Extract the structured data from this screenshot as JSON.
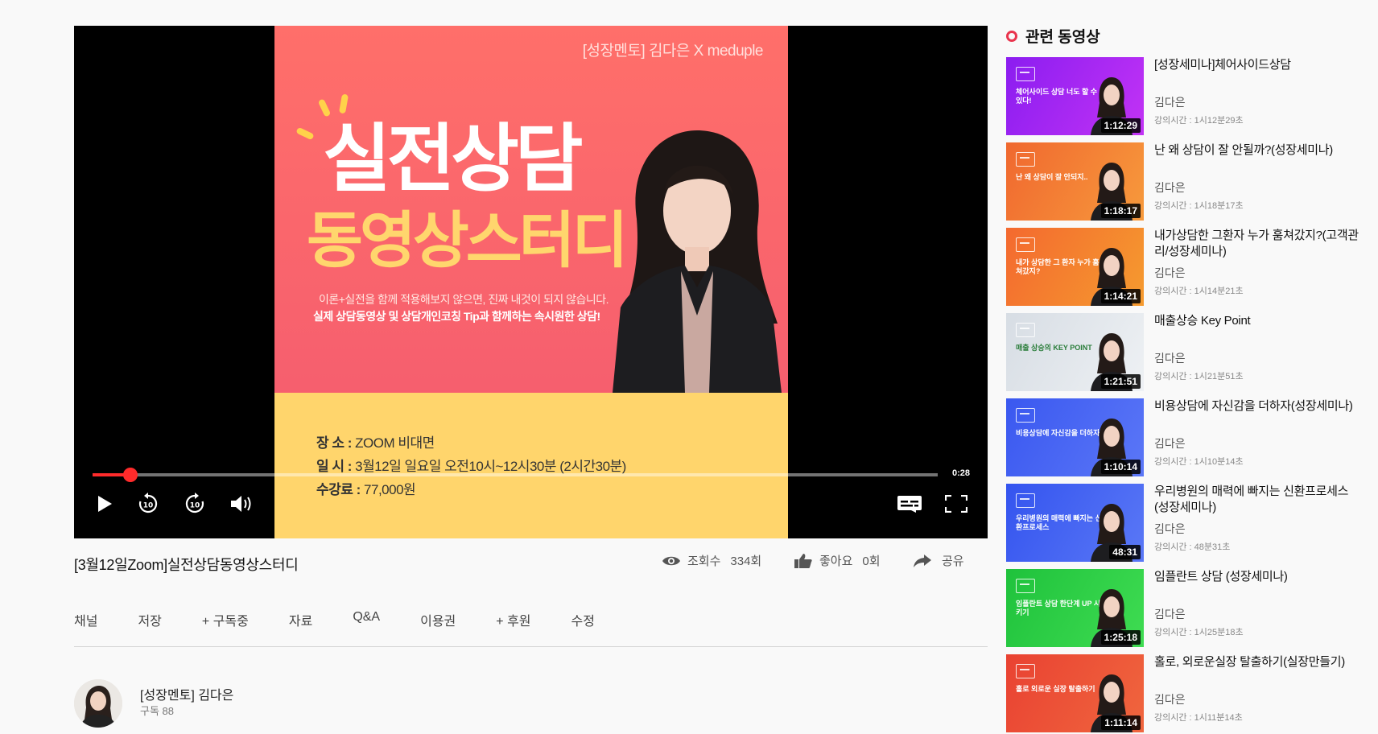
{
  "player": {
    "poster": {
      "brand": "[성장멘토] 김다은 X meduple",
      "title_line1": "실전상담",
      "title_line2": "동영상스터디",
      "subtitle_line1": "이론+실전을 함께 적용해보지 않으면, 진짜 내것이 되지 않습니다.",
      "subtitle_line2": "실제 상담동영상 및 상담개인코칭 Tip과 함께하는 속시원한 상담!",
      "info": [
        {
          "label": "장  소 :",
          "value": "ZOOM 비대면"
        },
        {
          "label": "일  시 :",
          "value": "3월12일 일요일 오전10시~12시30분 (2시간30분)"
        },
        {
          "label": "수강료 :",
          "value": "77,000원"
        }
      ]
    },
    "progress": 0.045,
    "current_time": "0:28",
    "colors": {
      "progress": "#ff2b2b",
      "poster_top": "#ff6f6a",
      "poster_bottom": "#ffd56c"
    }
  },
  "video": {
    "title": "[3월12일Zoom]실전상담동영상스터디",
    "views_label": "조회수",
    "views_value": "334회",
    "likes_label": "좋아요",
    "likes_value": "0회",
    "share_label": "공유"
  },
  "actions": [
    "채널",
    "저장",
    "+ 구독중",
    "자료",
    "Q&A",
    "이용권",
    "+ 후원",
    "수정"
  ],
  "channel": {
    "name": "[성장멘토] 김다은",
    "subscribers": "구독 88"
  },
  "sidebar": {
    "heading": "관련 동영상",
    "accent": "#e9344d",
    "items": [
      {
        "title": "[성장세미나]체어사이드상담",
        "author": "김다은",
        "time": "강의시간 : 1시12분29초",
        "duration": "1:12:29",
        "color1": "#8b1df0",
        "color2": "#c233f5",
        "thumb_text": "체어사이드 상담 너도 할 수 있다!"
      },
      {
        "title": "난 왜 상담이 잘 안될까?(성장세미나)",
        "author": "김다은",
        "time": "강의시간 : 1시18분17초",
        "duration": "1:18:17",
        "color1": "#f0682f",
        "color2": "#f79a3c",
        "thumb_text": "난 왜 상담이 잘 안되지.."
      },
      {
        "title": "내가상담한 그환자 누가 훔쳐갔지?(고객관리/성장세미나)",
        "author": "김다은",
        "time": "강의시간 : 1시14분21초",
        "duration": "1:14:21",
        "color1": "#f4692f",
        "color2": "#f59b2f",
        "thumb_text": "내가 상담한 그 환자 누가 훔쳐갔지?"
      },
      {
        "title": "매출상승 Key Point",
        "author": "김다은",
        "time": "강의시간 : 1시21분51초",
        "duration": "1:21:51",
        "color1": "#d7dde4",
        "color2": "#eef1f4",
        "thumb_text": "매출 상승의 KEY POINT"
      },
      {
        "title": "비용상담에 자신감을 더하자(성장세미나)",
        "author": "김다은",
        "time": "강의시간 : 1시10분14초",
        "duration": "1:10:14",
        "color1": "#3a58f0",
        "color2": "#5b77f7",
        "thumb_text": "비용상담에 자신감을 더하자"
      },
      {
        "title": "우리병원의 매력에 빠지는 신환프로세스 (성장세미나)",
        "author": "김다은",
        "time": "강의시간 : 48분31초",
        "duration": "48:31",
        "color1": "#3454ef",
        "color2": "#5a78f6",
        "thumb_text": "우리병원의 매력에 빠지는 신환프로세스"
      },
      {
        "title": "임플란트 상담 (성장세미나)",
        "author": "김다은",
        "time": "강의시간 : 1시25분18초",
        "duration": "1:25:18",
        "color1": "#1fc23c",
        "color2": "#3fdc52",
        "thumb_text": "임플란트 상담 한단계 UP 시키기"
      },
      {
        "title": "홀로, 외로운실장 탈출하기(실장만들기)",
        "author": "김다은",
        "time": "강의시간 : 1시11분14초",
        "duration": "1:11:14",
        "color1": "#e94232",
        "color2": "#f0663e",
        "thumb_text": "홀로 외로운 실장 탈출하기"
      }
    ]
  }
}
